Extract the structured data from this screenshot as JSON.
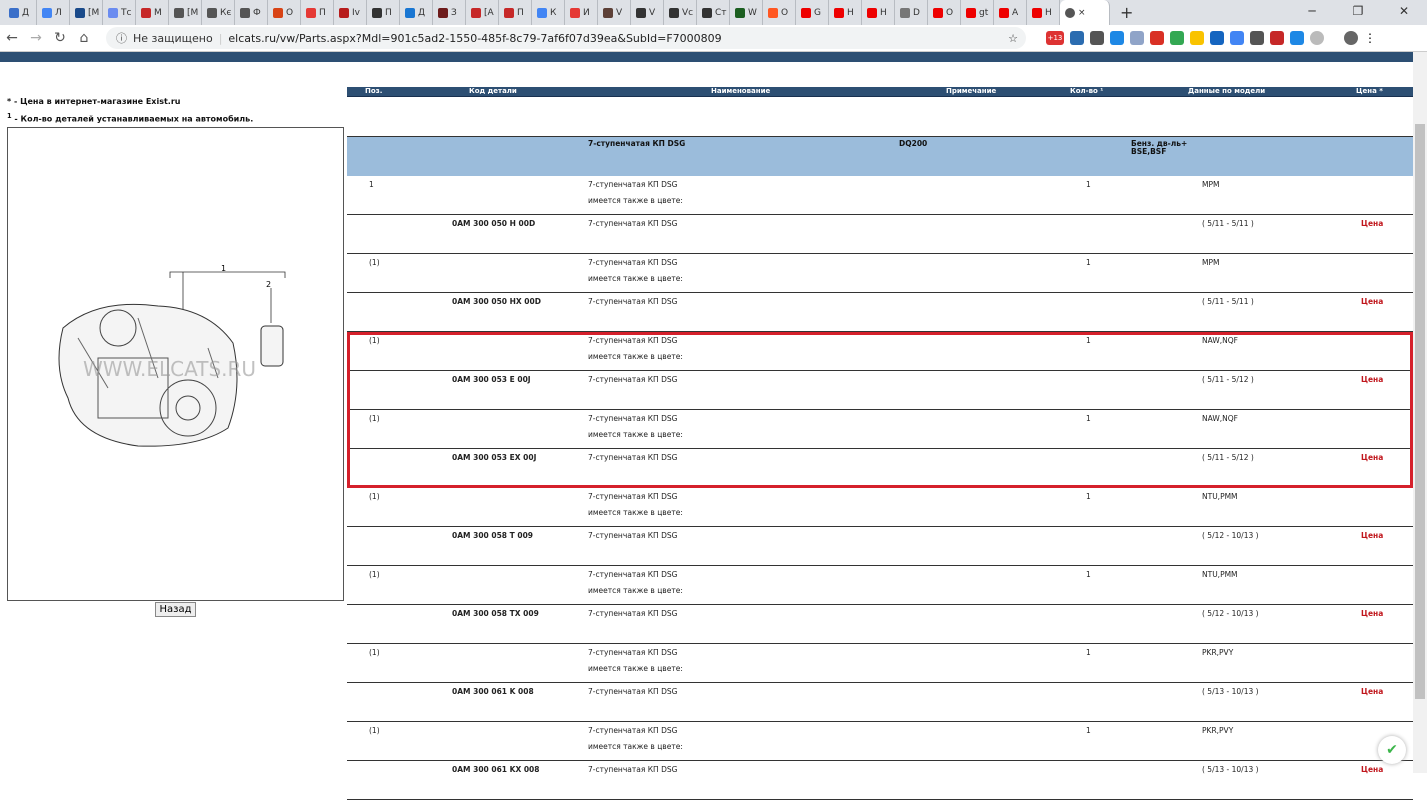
{
  "browser": {
    "tabs": [
      "Д",
      "Л",
      "[M",
      "Тс",
      "M",
      "[M",
      "Кє",
      "Ф",
      "О",
      "П",
      "Iv",
      "П",
      "Д",
      "З",
      "[A",
      "П",
      "К",
      "И",
      "V",
      "V",
      "Vc",
      "Ст",
      "W",
      "O",
      "G",
      "H",
      "H",
      "D",
      "O",
      "gt",
      "A",
      "H"
    ],
    "tab_colors": [
      "#3b6fc9",
      "#4285f4",
      "#1a4a8a",
      "#6b8cf0",
      "#c62828",
      "#555",
      "#555",
      "#555",
      "#d84315",
      "#e53935",
      "#b71c1c",
      "#333",
      "#1976d2",
      "#6d1b1b",
      "#c62828",
      "#c62828",
      "#4285f4",
      "#e53935",
      "#5d4037",
      "#333",
      "#333",
      "#333",
      "#1b5e20",
      "#ff5722",
      "#e00",
      "#e00",
      "#e00",
      "#777",
      "#e00",
      "#e00",
      "#e00",
      "#e00"
    ],
    "active_tab": "×",
    "security_label": "Не защищено",
    "url": "elcats.ru/vw/Parts.aspx?Mdl=901c5ad2-1550-485f-8c79-7af6f07d39ea&SubId=F7000809",
    "ext_badge": "+13"
  },
  "notes": {
    "price_note": "* - Цена в интернет-магазине Exist.ru",
    "qty_sup": "1",
    "qty_note": " - Кол-во деталей устанавливаемых на автомобиль."
  },
  "illustration": {
    "watermark": "WWW.ELCATS.RU",
    "callout_1": "1",
    "callout_2": "2"
  },
  "back_button": "Назад",
  "table": {
    "headers": {
      "pos": "Поз.",
      "code": "Код детали",
      "name": "Наименование",
      "note": "Примечание",
      "qty": "Кол-во ¹",
      "model": "Данные по модели",
      "price": "Цена *"
    },
    "group": {
      "name": "7-ступенчатая КП DSG",
      "note": "DQ200",
      "model1": "Бенз. дв-ль+",
      "model2": "BSE,BSF"
    },
    "rows": [
      {
        "pos": "1",
        "name": "7-ступенчатая КП DSG",
        "sub": "имеется также в цвете:",
        "qty": "1",
        "model": "MPM"
      },
      {
        "code": "0AM 300 050 H 00D",
        "name": "7-ступенчатая КП DSG",
        "model": "( 5/11 - 5/11 )",
        "price": "Цена"
      },
      {
        "pos": "(1)",
        "name": "7-ступенчатая КП DSG",
        "sub": "имеется также в цвете:",
        "qty": "1",
        "model": "MPM"
      },
      {
        "code": "0AM 300 050 HX 00D",
        "name": "7-ступенчатая КП DSG",
        "model": "( 5/11 - 5/11 )",
        "price": "Цена"
      },
      {
        "pos": "(1)",
        "name": "7-ступенчатая КП DSG",
        "sub": "имеется также в цвете:",
        "qty": "1",
        "model": "NAW,NQF"
      },
      {
        "code": "0AM 300 053 E 00J",
        "name": "7-ступенчатая КП DSG",
        "model": "( 5/11 - 5/12 )",
        "price": "Цена"
      },
      {
        "pos": "(1)",
        "name": "7-ступенчатая КП DSG",
        "sub": "имеется также в цвете:",
        "qty": "1",
        "model": "NAW,NQF"
      },
      {
        "code": "0AM 300 053 EX 00J",
        "name": "7-ступенчатая КП DSG",
        "model": "( 5/11 - 5/12 )",
        "price": "Цена"
      },
      {
        "pos": "(1)",
        "name": "7-ступенчатая КП DSG",
        "sub": "имеется также в цвете:",
        "qty": "1",
        "model": "NTU,PMM"
      },
      {
        "code": "0AM 300 058 T 009",
        "name": "7-ступенчатая КП DSG",
        "model": "( 5/12 - 10/13 )",
        "price": "Цена"
      },
      {
        "pos": "(1)",
        "name": "7-ступенчатая КП DSG",
        "sub": "имеется также в цвете:",
        "qty": "1",
        "model": "NTU,PMM"
      },
      {
        "code": "0AM 300 058 TX 009",
        "name": "7-ступенчатая КП DSG",
        "model": "( 5/12 - 10/13 )",
        "price": "Цена"
      },
      {
        "pos": "(1)",
        "name": "7-ступенчатая КП DSG",
        "sub": "имеется также в цвете:",
        "qty": "1",
        "model": "PKR,PVY"
      },
      {
        "code": "0AM 300 061 K 008",
        "name": "7-ступенчатая КП DSG",
        "model": "( 5/13 - 10/13 )",
        "price": "Цена"
      },
      {
        "pos": "(1)",
        "name": "7-ступенчатая КП DSG",
        "sub": "имеется также в цвете:",
        "qty": "1",
        "model": "PKR,PVY"
      },
      {
        "code": "0AM 300 061 KX 008",
        "name": "7-ступенчатая КП DSG",
        "model": "( 5/13 - 10/13 )",
        "price": "Цена"
      }
    ]
  }
}
